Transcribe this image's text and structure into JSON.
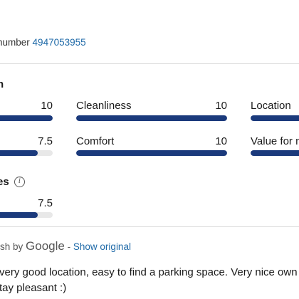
{
  "booking": {
    "label": "number",
    "number": "4947053955"
  },
  "ratings": {
    "section_title": "n",
    "items": [
      {
        "label": "",
        "score": "10",
        "fraction": 1.0
      },
      {
        "label": "Cleanliness",
        "score": "10",
        "fraction": 1.0
      },
      {
        "label": "Location",
        "score": "",
        "fraction": 1.0
      },
      {
        "label": "",
        "score": "7.5",
        "fraction": 0.75
      },
      {
        "label": "Comfort",
        "score": "10",
        "fraction": 1.0
      },
      {
        "label": "Value for m",
        "score": "",
        "fraction": 1.0
      }
    ]
  },
  "amenities": {
    "section_title": "es",
    "info_icon": "info-icon",
    "score": "7.5",
    "fraction": 0.75
  },
  "translation": {
    "prefix": "ish by",
    "provider": "Google",
    "separator": "-",
    "link": "Show original"
  },
  "review": {
    "line1": "very good location, easy to find a parking space. Very nice own",
    "line2": "tay pleasant :)"
  },
  "colors": {
    "bar_fill": "#1b3a7c",
    "bar_track": "#e8e8e8",
    "link": "#1f6aa8"
  }
}
